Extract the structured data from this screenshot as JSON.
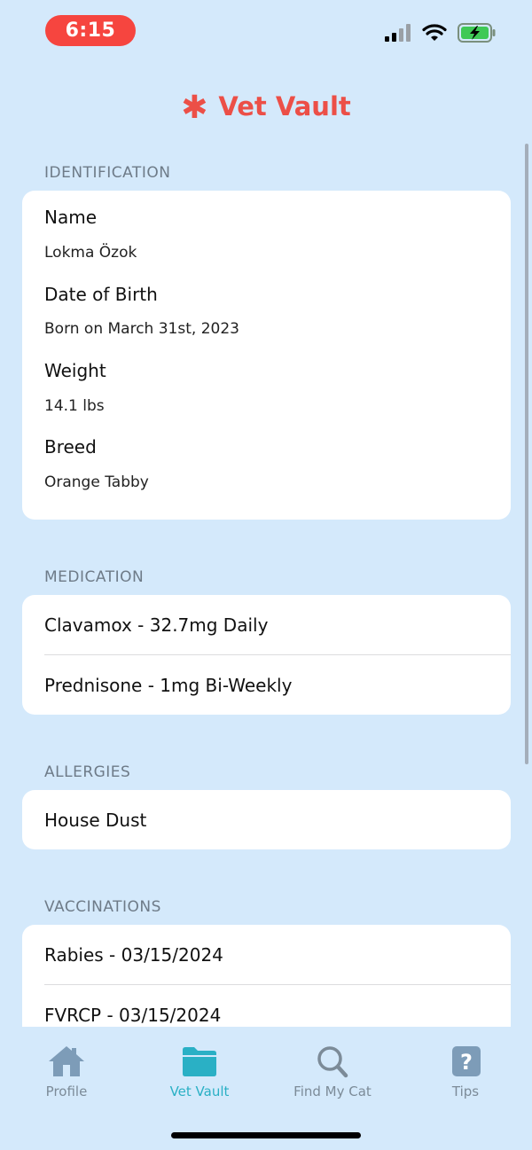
{
  "status_bar": {
    "time": "6:15",
    "time_pill_color": "#f6453f",
    "icons": [
      "cellular-signal-icon",
      "wifi-icon",
      "battery-charging-icon"
    ]
  },
  "header": {
    "title": "Vet Vault",
    "title_icon": "asterisk-icon",
    "accent_color": "#ec4f47"
  },
  "identification": {
    "header": "IDENTIFICATION",
    "fields": [
      {
        "label": "Name",
        "value": "Lokma Özok"
      },
      {
        "label": "Date of Birth",
        "value": "Born on March 31st, 2023"
      },
      {
        "label": "Weight",
        "value": "14.1 lbs"
      },
      {
        "label": "Breed",
        "value": "Orange Tabby"
      }
    ]
  },
  "medication": {
    "header": "MEDICATION",
    "items": [
      "Clavamox - 32.7mg Daily",
      "Prednisone - 1mg Bi-Weekly"
    ]
  },
  "allergies": {
    "header": "ALLERGIES",
    "items": [
      "House Dust"
    ]
  },
  "vaccinations": {
    "header": "VACCINATIONS",
    "items": [
      "Rabies - 03/15/2024",
      "FVRCP - 03/15/2024"
    ]
  },
  "tab_bar": {
    "tabs": [
      {
        "label": "Profile",
        "icon": "house-icon",
        "active": false
      },
      {
        "label": "Vet Vault",
        "icon": "folder-icon",
        "active": true
      },
      {
        "label": "Find My Cat",
        "icon": "magnifying-glass-icon",
        "active": false
      },
      {
        "label": "Tips",
        "icon": "question-mark-icon",
        "active": false
      }
    ],
    "active_color": "#2ab0c5",
    "inactive_color": "#7c8b98"
  }
}
